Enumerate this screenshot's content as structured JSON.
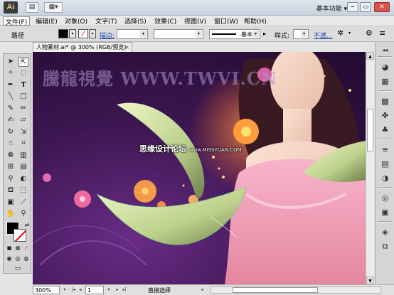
{
  "app": {
    "logo": "Ai",
    "workspace": "基本功能",
    "window_buttons": {
      "minimize": "–",
      "restore": "▭",
      "close": "✕"
    }
  },
  "menu": {
    "items": [
      "文件(F)",
      "编辑(E)",
      "对象(O)",
      "文字(T)",
      "选择(S)",
      "效果(C)",
      "视图(V)",
      "窗口(W)",
      "帮助(H)"
    ]
  },
  "control_bar": {
    "selection_label": "路径",
    "stroke_label": "描边:",
    "brush_label": "基本",
    "style_label": "样式:",
    "opacity_label": "不透..."
  },
  "document": {
    "tab_title": "人物素材.ai* @ 300% (RGB/预览)",
    "watermark": "騰龍視覺 WWW.TWVI.CN",
    "forum_text": "思缘设计论坛",
    "forum_url": "www.MISSYUAN.COM"
  },
  "status_bar": {
    "zoom": "300%",
    "page": "1",
    "status_text": "直接选择"
  },
  "tools": [
    "selection-tool",
    "direct-selection-tool",
    "magic-wand-tool",
    "lasso-tool",
    "pen-tool",
    "type-tool",
    "line-tool",
    "rectangle-tool",
    "paintbrush-tool",
    "pencil-tool",
    "blob-brush-tool",
    "eraser-tool",
    "rotate-tool",
    "scale-tool",
    "warp-tool",
    "free-transform-tool",
    "symbol-sprayer-tool",
    "column-graph-tool",
    "mesh-tool",
    "gradient-tool",
    "eyedropper-tool",
    "blend-tool",
    "live-paint-tool",
    "live-paint-selection-tool",
    "artboard-tool",
    "slice-tool",
    "hand-tool",
    "zoom-tool"
  ]
}
